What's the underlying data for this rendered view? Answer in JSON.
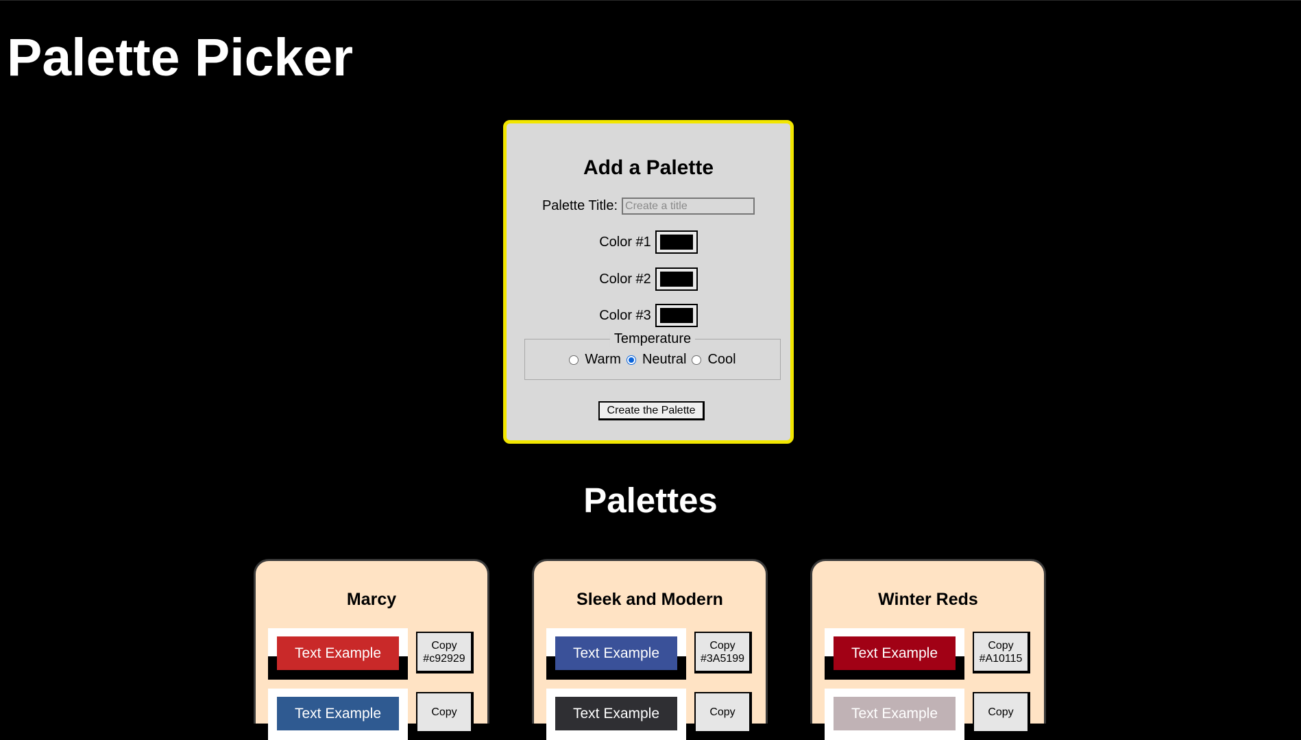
{
  "page": {
    "title": "Palette Picker"
  },
  "form": {
    "heading": "Add a Palette",
    "title_label": "Palette Title:",
    "title_value": "",
    "title_placeholder": "Create a title",
    "color1_label": "Color #1",
    "color2_label": "Color #2",
    "color3_label": "Color #3",
    "color1_value": "#000000",
    "color2_value": "#000000",
    "color3_value": "#000000",
    "temperature_legend": "Temperature",
    "temperature_options": [
      "Warm",
      "Neutral",
      "Cool"
    ],
    "temperature_selected": "Neutral",
    "submit_label": "Create the Palette",
    "accent_border": "#f2e600"
  },
  "palettes_section": {
    "title": "Palettes"
  },
  "palettes": [
    {
      "name": "Marcy",
      "colors": [
        {
          "sample_text": "Text Example",
          "copy_label": "Copy",
          "hex": "#c92929",
          "hex_label": "#c92929"
        },
        {
          "sample_text": "Text Example",
          "copy_label": "Copy",
          "hex": "#2f5a91",
          "hex_label": ""
        }
      ]
    },
    {
      "name": "Sleek and Modern",
      "colors": [
        {
          "sample_text": "Text Example",
          "copy_label": "Copy",
          "hex": "#3A5199",
          "hex_label": "#3A5199"
        },
        {
          "sample_text": "Text Example",
          "copy_label": "Copy",
          "hex": "#2f2f33",
          "hex_label": ""
        }
      ]
    },
    {
      "name": "Winter Reds",
      "colors": [
        {
          "sample_text": "Text Example",
          "copy_label": "Copy",
          "hex": "#A10115",
          "hex_label": "#A10115"
        },
        {
          "sample_text": "Text Example",
          "copy_label": "Copy",
          "hex": "#c0b2b5",
          "hex_label": ""
        }
      ]
    }
  ],
  "colors": {
    "background": "#000000",
    "card": "#ffe3c4",
    "form_bg": "#d9d9d9"
  }
}
